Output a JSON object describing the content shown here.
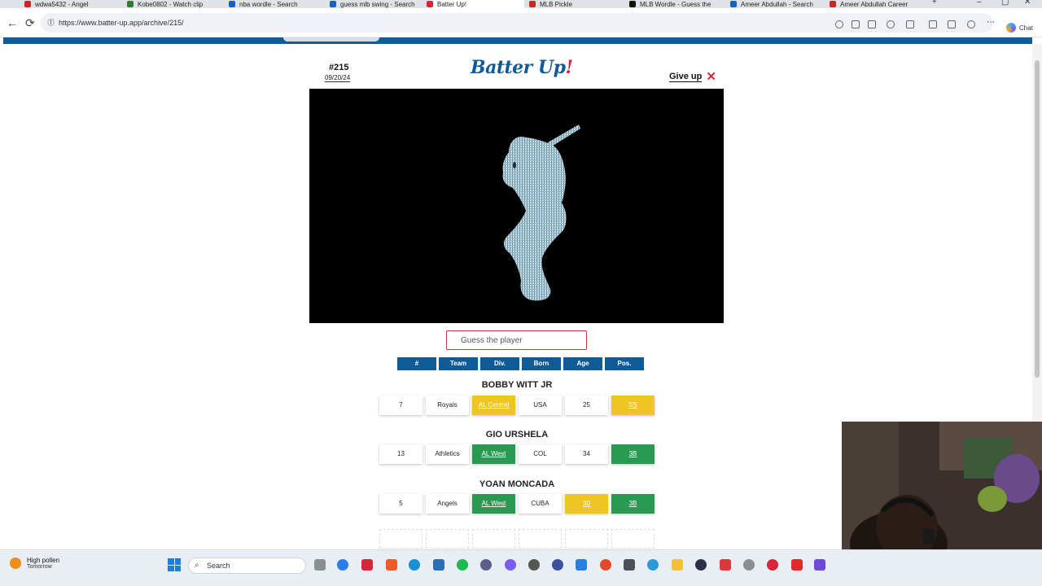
{
  "browser": {
    "tabs": [
      {
        "label": "wdwa5432 - Angel",
        "color": "#c62828",
        "active": false
      },
      {
        "label": "Kobe0802 - Watch clip",
        "color": "#2e7d32",
        "active": false
      },
      {
        "label": "nba wordle - Search",
        "color": "#1565c0",
        "active": false
      },
      {
        "label": "guess mlb swing - Search",
        "color": "#1565c0",
        "active": false
      },
      {
        "label": "Batter Up!",
        "color": "#d6263c",
        "active": true
      },
      {
        "label": "MLB Pickle",
        "color": "#c62828",
        "active": false
      },
      {
        "label": "MLB Wordle - Guess the",
        "color": "#111111",
        "active": false
      },
      {
        "label": "Ameer Abdullah - Search",
        "color": "#1565c0",
        "active": false
      },
      {
        "label": "Ameer Abdullah Career",
        "color": "#c62828",
        "active": false
      }
    ],
    "url": "https://www.batter-up.app/archive/215/",
    "chat_label": "Chat"
  },
  "game": {
    "puzzle_number": "#215",
    "puzzle_date": "09/20/24",
    "title_main": "Batter Up",
    "title_bang": "!",
    "give_up_label": "Give up",
    "guess_placeholder": "Guess the player",
    "columns": [
      "#",
      "Team",
      "Div.",
      "Born",
      "Age",
      "Pos."
    ],
    "guesses": [
      {
        "name": "BOBBY WITT JR",
        "cells": [
          {
            "value": "7",
            "status": "none"
          },
          {
            "value": "Royals",
            "status": "none"
          },
          {
            "value": "AL Central",
            "status": "yellow"
          },
          {
            "value": "USA",
            "status": "none"
          },
          {
            "value": "25",
            "status": "none"
          },
          {
            "value": "SS",
            "status": "yellow"
          }
        ]
      },
      {
        "name": "GIO URSHELA",
        "cells": [
          {
            "value": "13",
            "status": "none"
          },
          {
            "value": "Athletics",
            "status": "none"
          },
          {
            "value": "AL West",
            "status": "green"
          },
          {
            "value": "COL",
            "status": "none"
          },
          {
            "value": "34",
            "status": "none"
          },
          {
            "value": "3B",
            "status": "green"
          }
        ]
      },
      {
        "name": "YOAN MONCADA",
        "cells": [
          {
            "value": "5",
            "status": "none"
          },
          {
            "value": "Angels",
            "status": "none"
          },
          {
            "value": "AL West",
            "status": "green"
          },
          {
            "value": "CUBA",
            "status": "none"
          },
          {
            "value": "30",
            "status": "yellow"
          },
          {
            "value": "3B",
            "status": "green"
          }
        ]
      }
    ]
  },
  "taskbar": {
    "weather_title": "High pollen",
    "weather_sub": "Tomorrow",
    "search_label": "Search"
  },
  "colors": {
    "brand_blue": "#0f5b9a",
    "accent_red": "#d6263c",
    "match_green": "#2a9a52",
    "close_yellow": "#efc524"
  }
}
